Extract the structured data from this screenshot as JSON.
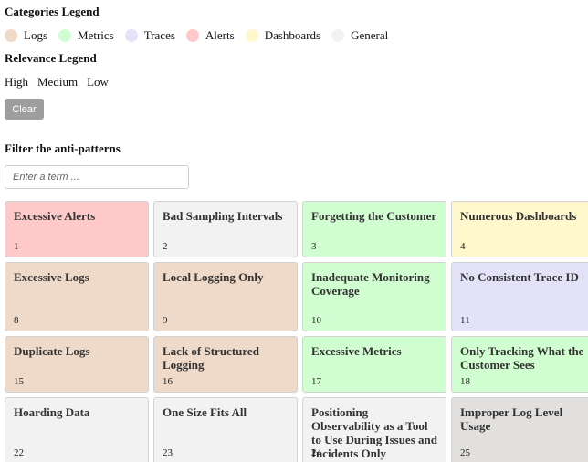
{
  "legend": {
    "categories_title": "Categories Legend",
    "categories": [
      {
        "label": "Logs",
        "color": "#efd9c9"
      },
      {
        "label": "Metrics",
        "color": "#d1fed1"
      },
      {
        "label": "Traces",
        "color": "#e3e2f8"
      },
      {
        "label": "Alerts",
        "color": "#ffc9c9"
      },
      {
        "label": "Dashboards",
        "color": "#fff8cc"
      },
      {
        "label": "General",
        "color": "#f2f2f2"
      }
    ],
    "relevance_title": "Relevance Legend",
    "relevance": [
      "High",
      "Medium",
      "Low"
    ]
  },
  "controls": {
    "clear_label": "Clear",
    "filter_title": "Filter the anti-patterns",
    "search_placeholder": "Enter a term ..."
  },
  "cards": [
    {
      "title": "Excessive Alerts",
      "number": "1",
      "category": "alerts"
    },
    {
      "title": "Bad Sampling Intervals",
      "number": "2",
      "category": "general"
    },
    {
      "title": "Forgetting the Customer",
      "number": "3",
      "category": "metrics"
    },
    {
      "title": "Numerous Dashboards",
      "number": "4",
      "category": "dashboards"
    },
    {
      "title": "Excessive Logs",
      "number": "8",
      "category": "logs"
    },
    {
      "title": "Local Logging Only",
      "number": "9",
      "category": "logs"
    },
    {
      "title": "Inadequate Monitoring Coverage",
      "number": "10",
      "category": "metrics"
    },
    {
      "title": "No Consistent Trace ID",
      "number": "11",
      "category": "traces"
    },
    {
      "title": "Duplicate Logs",
      "number": "15",
      "category": "logs"
    },
    {
      "title": "Lack of Structured Logging",
      "number": "16",
      "category": "logs"
    },
    {
      "title": "Excessive Metrics",
      "number": "17",
      "category": "metrics"
    },
    {
      "title": "Only Tracking What the Customer Sees",
      "number": "18",
      "category": "metrics"
    },
    {
      "title": "Hoarding Data",
      "number": "22",
      "category": "general"
    },
    {
      "title": "One Size Fits All",
      "number": "23",
      "category": "general"
    },
    {
      "title": "Positioning Observability as a Tool to Use During Issues and Incidents Only",
      "number": "24",
      "category": "general"
    },
    {
      "title": "Improper Log Level Usage",
      "number": "25",
      "category": "logs-grey"
    }
  ]
}
